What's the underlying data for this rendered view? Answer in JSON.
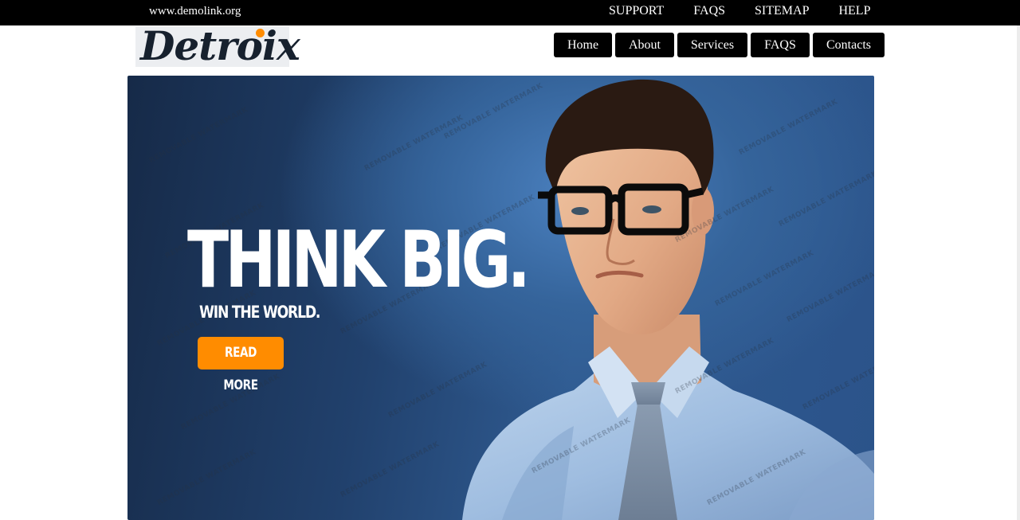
{
  "topbar": {
    "site_url": "www.demolink.org",
    "links": [
      "SUPPORT",
      "FAQS",
      "SITEMAP",
      "HELP"
    ]
  },
  "logo": {
    "text": "Detroix"
  },
  "nav": {
    "items": [
      "Home",
      "About",
      "Services",
      "FAQS",
      "Contacts"
    ]
  },
  "hero": {
    "headline": "THINK BIG.",
    "tagline": "WIN THE WORLD.",
    "button_label": "READ MORE",
    "watermark_text": "REMOVABLE WATERMARK"
  },
  "colors": {
    "accent": "#ff8c00",
    "topbar": "#000000",
    "nav_bg": "#000000",
    "hero_blue": "#2f5a90"
  }
}
